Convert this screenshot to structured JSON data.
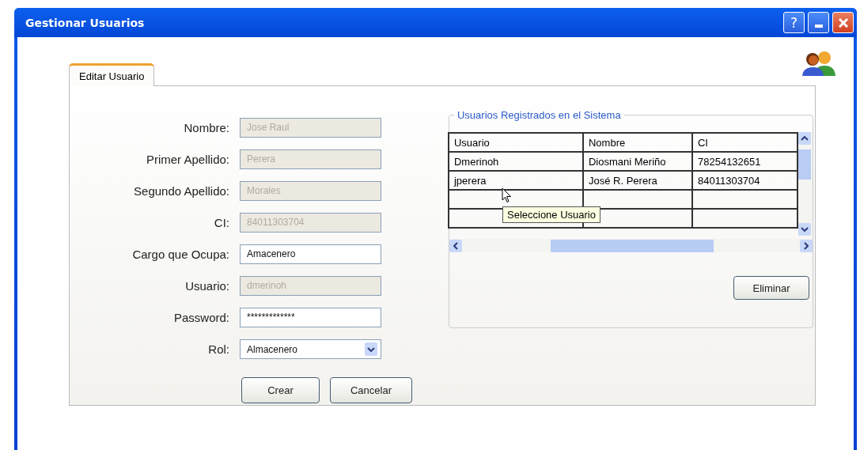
{
  "window": {
    "title": "Gestionar Usuarios",
    "controls": [
      {
        "kind": "help",
        "label": "?"
      },
      {
        "kind": "minimize"
      },
      {
        "kind": "close"
      }
    ]
  },
  "tabs": [
    {
      "label": "Editar Usuario",
      "selected": true
    }
  ],
  "form": {
    "fields": [
      {
        "kind": "text",
        "label": "Nombre:",
        "value": "Jose Raul",
        "disabled": true
      },
      {
        "kind": "text",
        "label": "Primer Apellido:",
        "value": "Perera",
        "disabled": true
      },
      {
        "kind": "text",
        "label": "Segundo Apellido:",
        "value": "Morales",
        "disabled": true
      },
      {
        "kind": "text",
        "label": "CI:",
        "value": "84011303704",
        "disabled": true
      },
      {
        "kind": "text",
        "label": "Cargo que Ocupa:",
        "value": "Amacenero",
        "disabled": false
      },
      {
        "kind": "text",
        "label": "Usuario:",
        "value": "dmerinoh",
        "disabled": true
      },
      {
        "kind": "password",
        "label": "Password:",
        "value": "*************",
        "disabled": false
      },
      {
        "kind": "select",
        "label": "Rol:",
        "value": "Almacenero",
        "disabled": false
      }
    ],
    "buttons": [
      "Crear",
      "Cancelar"
    ]
  },
  "users_group": {
    "title": "Usuarios Registrados en el Sistema",
    "table": {
      "columns": [
        "Usuario",
        "Nombre",
        "CI"
      ],
      "rows": [
        [
          "Dmerinoh",
          "Diosmani Meriño",
          "78254132651"
        ],
        [
          "jperera",
          "José R. Perera",
          "84011303704"
        ]
      ]
    },
    "tooltip": "Seleccione Usuario",
    "button": "Eliminar"
  }
}
